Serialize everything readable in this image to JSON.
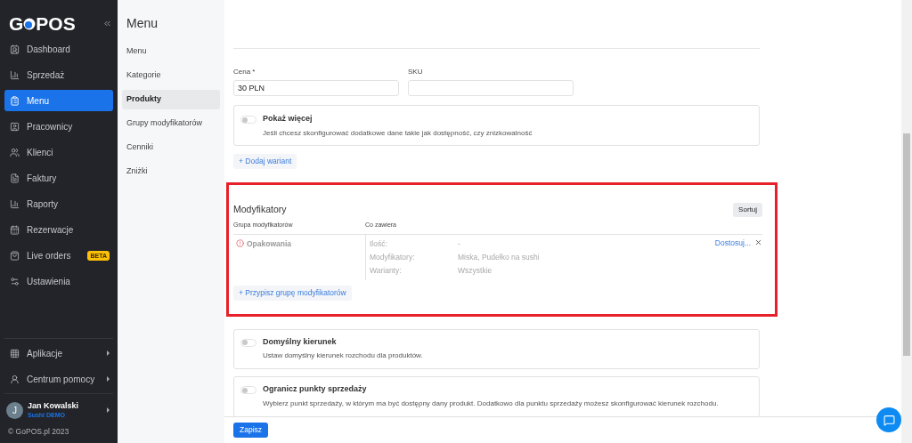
{
  "sidebar": {
    "logo": {
      "before": "G",
      "after": "POS"
    },
    "items": [
      {
        "label": "Dashboard",
        "selected": false
      },
      {
        "label": "Sprzedaż",
        "selected": false
      },
      {
        "label": "Menu",
        "selected": true
      },
      {
        "label": "Pracownicy",
        "selected": false
      },
      {
        "label": "Klienci",
        "selected": false
      },
      {
        "label": "Faktury",
        "selected": false
      },
      {
        "label": "Raporty",
        "selected": false
      },
      {
        "label": "Rezerwacje",
        "selected": false
      },
      {
        "label": "Live orders",
        "selected": false,
        "badge": "BETA"
      },
      {
        "label": "Ustawienia",
        "selected": false
      }
    ],
    "bottom_items": [
      {
        "label": "Aplikacje"
      },
      {
        "label": "Centrum pomocy"
      }
    ],
    "user": {
      "initial": "J",
      "name": "Jan Kowalski",
      "venue": "Sushi DEMO"
    },
    "copyright": "© GoPOS.pl 2023"
  },
  "submenu": {
    "title": "Menu",
    "items": [
      {
        "label": "Menu",
        "selected": false
      },
      {
        "label": "Kategorie",
        "selected": false
      },
      {
        "label": "Produkty",
        "selected": true
      },
      {
        "label": "Grupy modyfikatorów",
        "selected": false
      },
      {
        "label": "Cenniki",
        "selected": false
      },
      {
        "label": "Zniżki",
        "selected": false
      }
    ]
  },
  "form": {
    "price": {
      "label": "Cena *",
      "value": "30 PLN"
    },
    "sku": {
      "label": "SKU"
    },
    "show_more": {
      "title": "Pokaż więcej",
      "description": "Jeśli chcesz skonfigurować dodatkowe dane takie jak dostępność, czy znizkowalność",
      "on": false
    },
    "add_variant": "+ Dodaj wariant"
  },
  "modifiers": {
    "title": "Modyfikatory",
    "sort_button": "Sortuj",
    "columns": [
      "Grupa modyfikatorów",
      "Co zawiera"
    ],
    "rows": [
      {
        "group": "Opakowania",
        "details": [
          {
            "label": "Ilość:",
            "value": "-"
          },
          {
            "label": "Modyfikatory:",
            "value": "Miska, Pudełko na sushi"
          },
          {
            "label": "Warianty:",
            "value": "Wszystkie"
          }
        ],
        "link": "Dostosuj..."
      }
    ],
    "assign_button": "+ Przypisz grupę modyfikatorów"
  },
  "options": [
    {
      "title": "Domyślny kierunek",
      "lines": [
        "Ustaw domyślny kierunek rozchodu dla produktów."
      ],
      "on": false
    },
    {
      "title": "Ogranicz punkty sprzedaży",
      "lines": [
        "Wybierz punkt sprzedaży, w którym ma być dostępny dany produkt. Dodatkowo dla punktu sprzedaży możesz skonfigurować kierunek rozchodu."
      ],
      "on": false
    }
  ],
  "footer": {
    "save_button": "Zapisz"
  }
}
